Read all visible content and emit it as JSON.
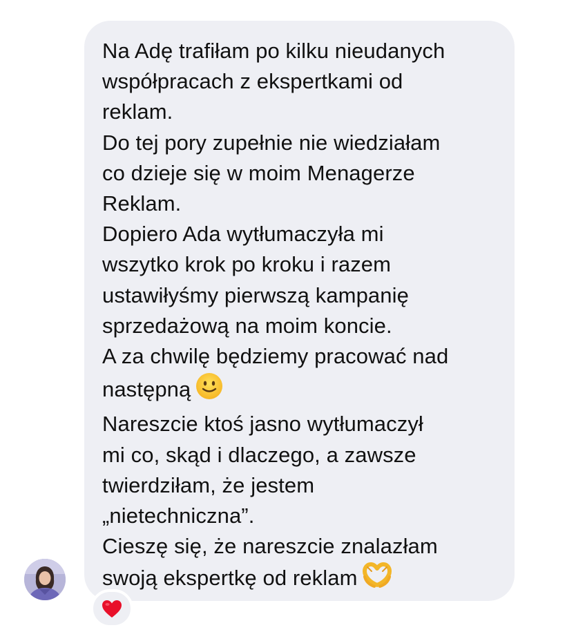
{
  "message": {
    "paragraphs": [
      "Na Adę trafiłam po kilku nieudanych\nwspółpracach z ekspertkami od\nreklam.",
      "Do tej pory zupełnie nie wiedziałam\nco dzieje się w moim Menagerze\nReklam.",
      "Dopiero Ada wytłumaczyła mi\nwszytko krok po kroku i razem\nustawiłyśmy pierwszą kampanię\nsprzedażową na moim koncie.",
      "A za chwilę będziemy pracować nad\nnastępną",
      "Nareszcie ktoś jasno wytłumaczył\nmi co, skąd i dlaczego, a zawsze\ntwierdziłam, że jestem\n„nietechniczna”.",
      "Cieszę się, że nareszcie znalazłam\nswoją ekspertkę od reklam"
    ],
    "emojis": [
      "smiling-face-emoji",
      "heart-hands-emoji"
    ]
  },
  "reaction": {
    "icon": "red-heart-icon",
    "color": "#e8102a"
  },
  "colors": {
    "bubble": "#eeeff4",
    "text": "#111111",
    "background": "#ffffff"
  }
}
